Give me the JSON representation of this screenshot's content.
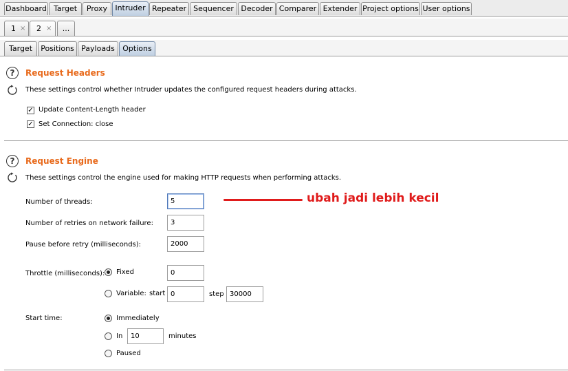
{
  "top_tabs": [
    "Dashboard",
    "Target",
    "Proxy",
    "Intruder",
    "Repeater",
    "Sequencer",
    "Decoder",
    "Comparer",
    "Extender",
    "Project options",
    "User options"
  ],
  "top_tab_active": "Intruder",
  "instance_tabs": [
    "1",
    "2",
    "..."
  ],
  "close_glyph": "×",
  "sub_tabs": [
    "Target",
    "Positions",
    "Payloads",
    "Options"
  ],
  "sub_tab_active": "Options",
  "request_headers": {
    "title": "Request Headers",
    "description": "These settings control whether Intruder updates the configured request headers during attacks.",
    "options": [
      {
        "label": "Update Content-Length header",
        "checked": true
      },
      {
        "label": "Set Connection: close",
        "checked": true
      }
    ]
  },
  "request_engine": {
    "title": "Request Engine",
    "description": "These settings control the engine used for making HTTP requests when performing attacks.",
    "threads_label": "Number of threads:",
    "threads_value": "5",
    "retries_label": "Number of retries on network failure:",
    "retries_value": "3",
    "pause_label": "Pause before retry (milliseconds):",
    "pause_value": "2000",
    "throttle_label": "Throttle (milliseconds):",
    "throttle_fixed_label": "Fixed",
    "throttle_fixed_value": "0",
    "throttle_variable_label": "Variable:",
    "throttle_start_label": "start",
    "throttle_start_value": "0",
    "throttle_step_label": "step",
    "throttle_step_value": "30000",
    "throttle_mode": "fixed",
    "start_time_label": "Start time:",
    "start_immediately_label": "Immediately",
    "start_in_label": "In",
    "start_in_value": "10",
    "start_minutes_label": "minutes",
    "start_paused_label": "Paused",
    "start_mode": "immediately"
  },
  "annotation": {
    "text": "ubah jadi lebih kecil",
    "color": "#e01b1b"
  },
  "colors": {
    "section_title": "#e86a1c",
    "active_tab": "#bfcfe2"
  }
}
